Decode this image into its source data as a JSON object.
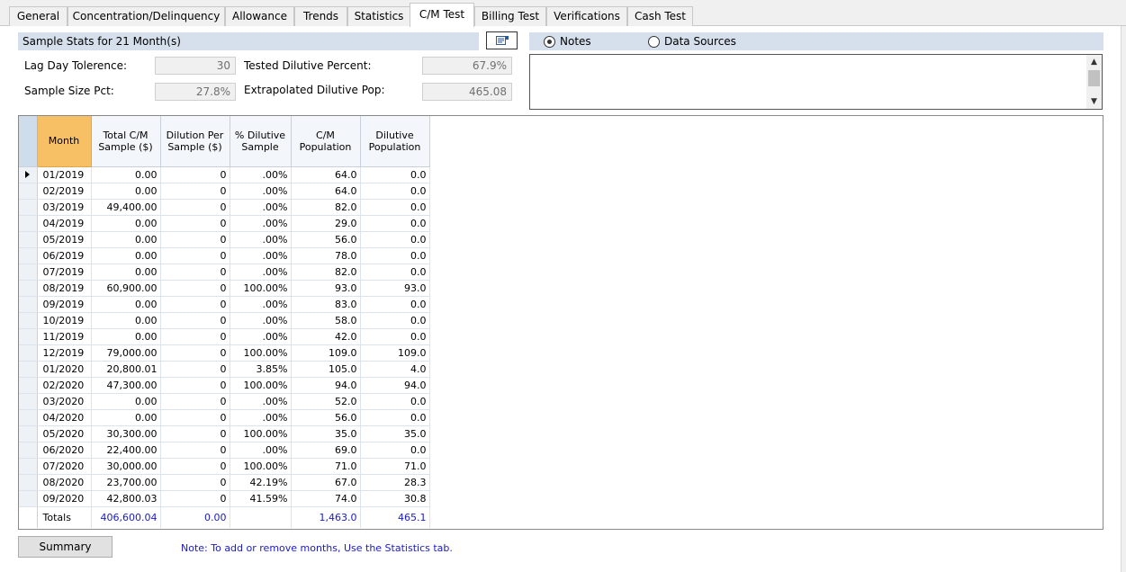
{
  "tabs": [
    {
      "label": "General",
      "active": false
    },
    {
      "label": "Concentration/Delinquency",
      "active": false
    },
    {
      "label": "Allowance",
      "active": false
    },
    {
      "label": "Trends",
      "active": false
    },
    {
      "label": "Statistics",
      "active": false
    },
    {
      "label": "C/M Test",
      "active": true
    },
    {
      "label": "Billing Test",
      "active": false
    },
    {
      "label": "Verifications",
      "active": false
    },
    {
      "label": "Cash Test",
      "active": false
    }
  ],
  "stats": {
    "title": "Sample Stats for 21 Month(s)",
    "lag_day_label": "Lag Day Tolerence:",
    "lag_day_value": "30",
    "sample_size_label": "Sample Size Pct:",
    "sample_size_value": "27.8%",
    "tested_dilutive_label": "Tested Dilutive Percent:",
    "tested_dilutive_value": "67.9%",
    "extrapolated_label": "Extrapolated Dilutive Pop:",
    "extrapolated_value": "465.08"
  },
  "notes_panel": {
    "notes_label": "Notes",
    "data_sources_label": "Data Sources",
    "selected": "Notes",
    "text": ""
  },
  "grid": {
    "columns": [
      "Month",
      "Total C/M Sample ($)",
      "Dilution Per Sample ($)",
      "% Dilutive Sample",
      "C/M Population",
      "Dilutive Population"
    ],
    "rows": [
      [
        "01/2019",
        "0.00",
        "0",
        ".00%",
        "64.0",
        "0.0"
      ],
      [
        "02/2019",
        "0.00",
        "0",
        ".00%",
        "64.0",
        "0.0"
      ],
      [
        "03/2019",
        "49,400.00",
        "0",
        ".00%",
        "82.0",
        "0.0"
      ],
      [
        "04/2019",
        "0.00",
        "0",
        ".00%",
        "29.0",
        "0.0"
      ],
      [
        "05/2019",
        "0.00",
        "0",
        ".00%",
        "56.0",
        "0.0"
      ],
      [
        "06/2019",
        "0.00",
        "0",
        ".00%",
        "78.0",
        "0.0"
      ],
      [
        "07/2019",
        "0.00",
        "0",
        ".00%",
        "82.0",
        "0.0"
      ],
      [
        "08/2019",
        "60,900.00",
        "0",
        "100.00%",
        "93.0",
        "93.0"
      ],
      [
        "09/2019",
        "0.00",
        "0",
        ".00%",
        "83.0",
        "0.0"
      ],
      [
        "10/2019",
        "0.00",
        "0",
        ".00%",
        "58.0",
        "0.0"
      ],
      [
        "11/2019",
        "0.00",
        "0",
        ".00%",
        "42.0",
        "0.0"
      ],
      [
        "12/2019",
        "79,000.00",
        "0",
        "100.00%",
        "109.0",
        "109.0"
      ],
      [
        "01/2020",
        "20,800.01",
        "0",
        "3.85%",
        "105.0",
        "4.0"
      ],
      [
        "02/2020",
        "47,300.00",
        "0",
        "100.00%",
        "94.0",
        "94.0"
      ],
      [
        "03/2020",
        "0.00",
        "0",
        ".00%",
        "52.0",
        "0.0"
      ],
      [
        "04/2020",
        "0.00",
        "0",
        ".00%",
        "56.0",
        "0.0"
      ],
      [
        "05/2020",
        "30,300.00",
        "0",
        "100.00%",
        "35.0",
        "35.0"
      ],
      [
        "06/2020",
        "22,400.00",
        "0",
        ".00%",
        "69.0",
        "0.0"
      ],
      [
        "07/2020",
        "30,000.00",
        "0",
        "100.00%",
        "71.0",
        "71.0"
      ],
      [
        "08/2020",
        "23,700.00",
        "0",
        "42.19%",
        "67.0",
        "28.3"
      ],
      [
        "09/2020",
        "42,800.03",
        "0",
        "41.59%",
        "74.0",
        "30.8"
      ]
    ],
    "totals": [
      "Totals",
      "406,600.04",
      "0.00",
      "",
      "1,463.0",
      "465.1"
    ]
  },
  "summary_button": "Summary",
  "note_text": "Note: To add or remove months, Use the Statistics tab.",
  "colors": {
    "header_band": "#d6e0ec",
    "selected_column_header": "#f7c064",
    "totals_text": "#1a1acc",
    "note_text": "#1a1acc"
  }
}
